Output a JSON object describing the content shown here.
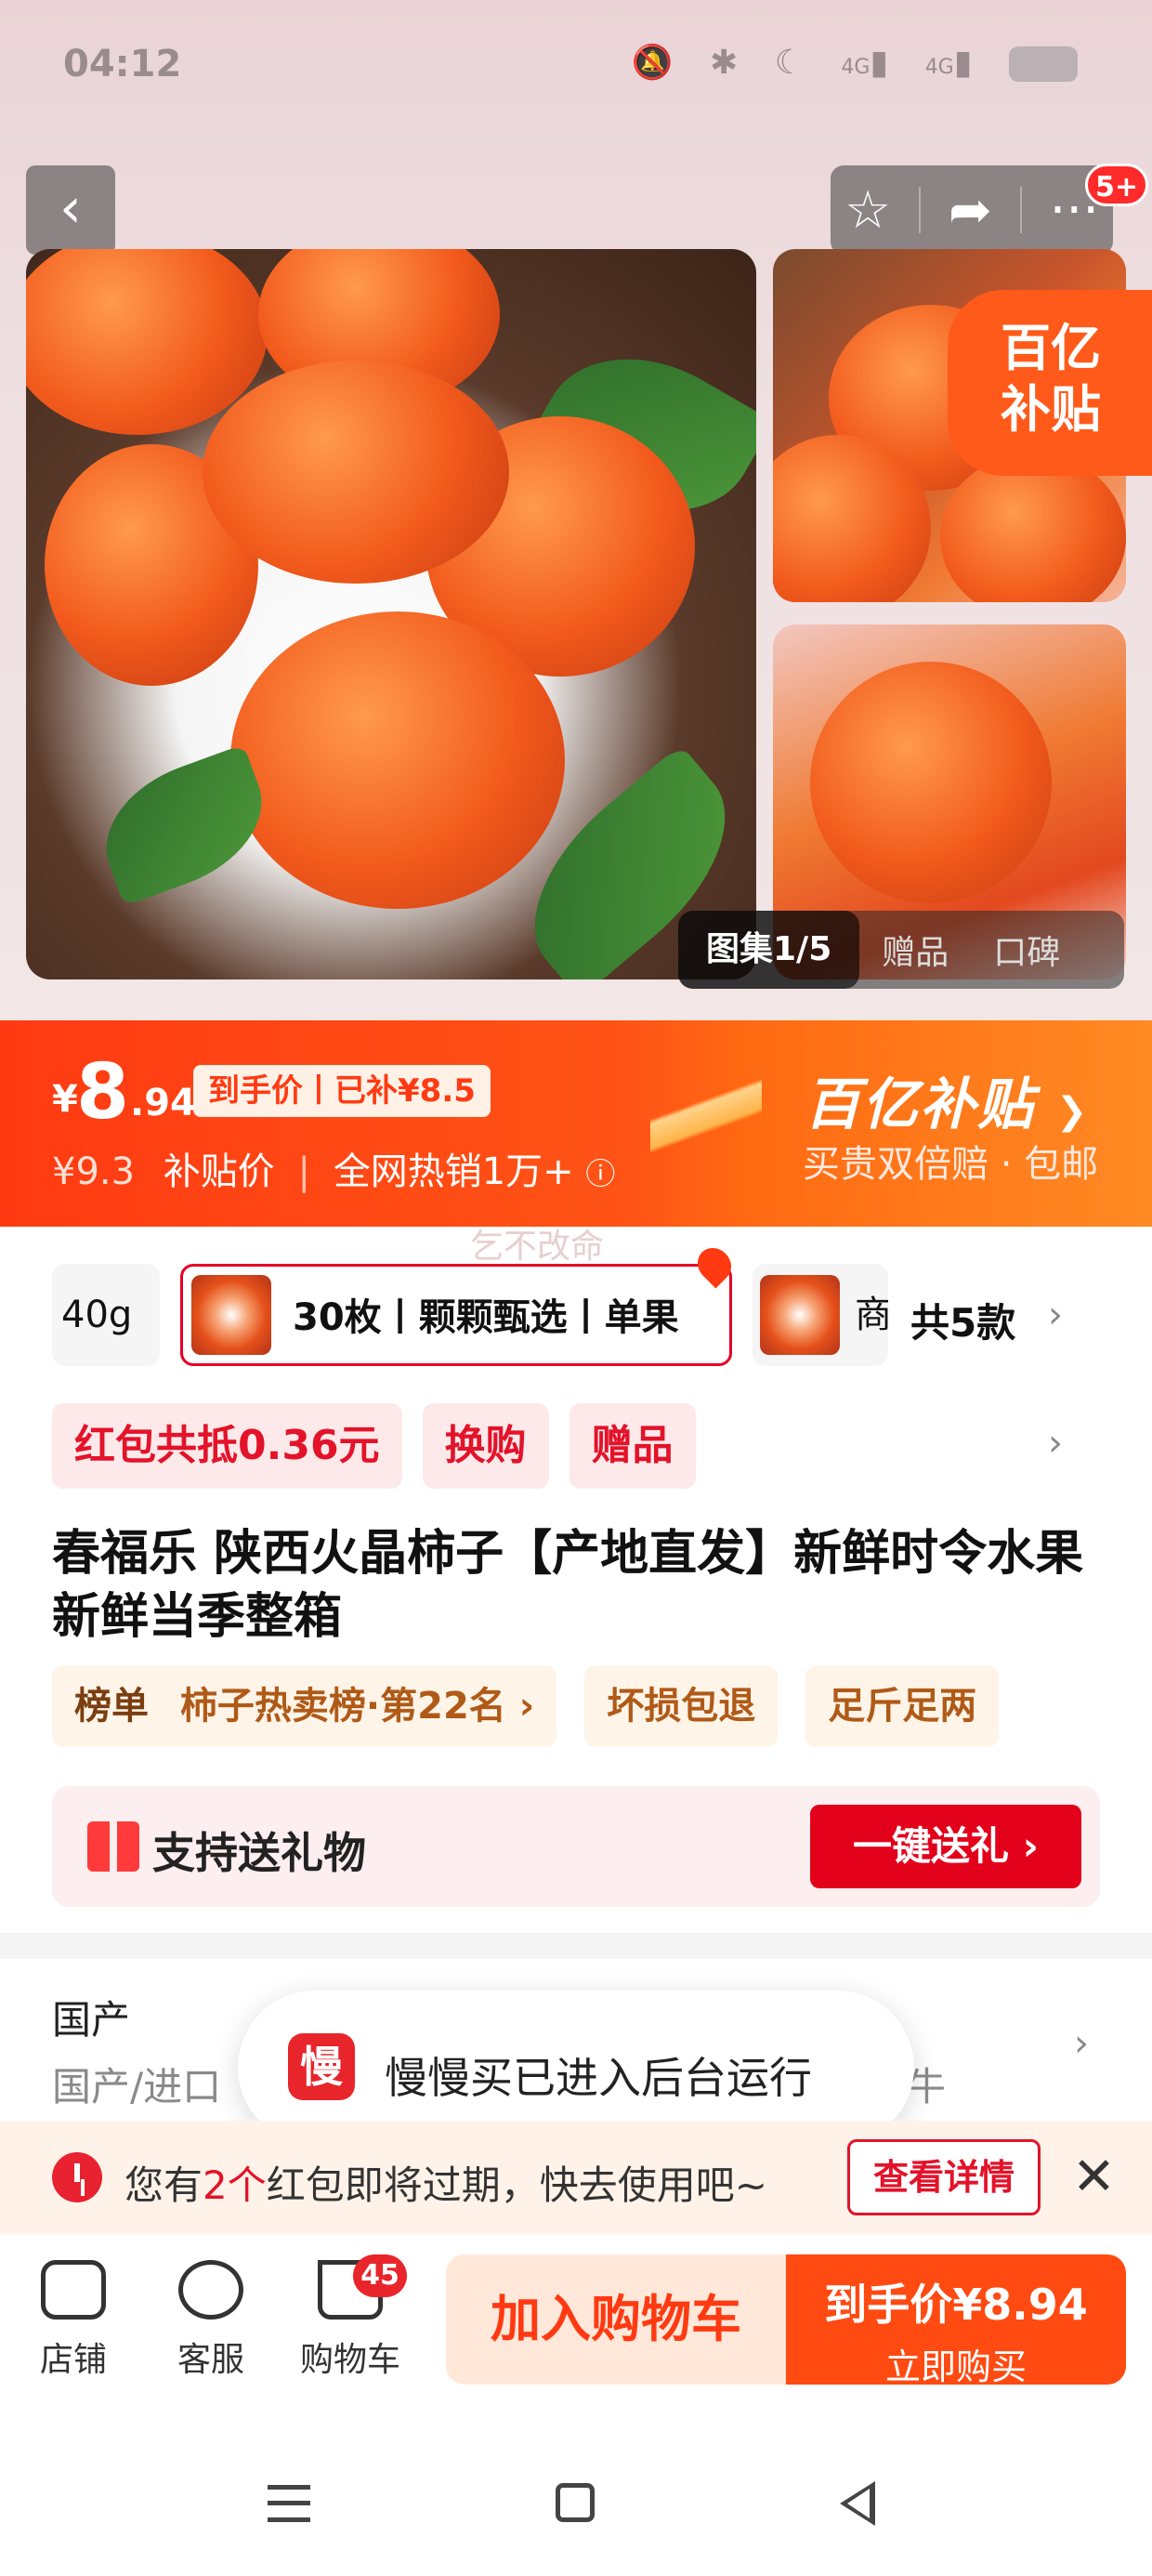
{
  "status_bar": {
    "time": "04:12",
    "icons": [
      "bell-off-icon",
      "bluetooth-icon",
      "moon-icon",
      "signal-4g-icon",
      "signal-4g-icon",
      "battery-icon"
    ],
    "network_1": "4G",
    "network_2": "4G"
  },
  "nav": {
    "back_icon": "chevron-left-icon",
    "favorite_icon": "star-icon",
    "share_icon": "share-icon",
    "more_icon": "more-dots-icon",
    "notification_badge": "5+"
  },
  "gallery": {
    "subsidy_tag_line1": "百亿",
    "subsidy_tag_line2": "补贴",
    "tabs": [
      {
        "label": "图集1/5",
        "active": true
      },
      {
        "label": "赠品",
        "active": false
      },
      {
        "label": "口碑",
        "active": false
      }
    ]
  },
  "price": {
    "currency": "¥",
    "integer": "8",
    "decimal": ".94",
    "tag": "到手价丨已补¥8.5",
    "original": "¥9.3",
    "original_label": "补贴价",
    "hot": "全网热销1万+",
    "info_icon": "info-icon",
    "promo_title": "百亿补贴",
    "promo_sub": "买贵双倍赔 · 包邮",
    "watermark": "乞不改命"
  },
  "variants": {
    "items": [
      {
        "label": "40g",
        "selected": false
      },
      {
        "label": "30枚丨颗颗甄选丨单果",
        "selected": true
      },
      {
        "label": "商",
        "selected": false
      }
    ],
    "total": "共5款"
  },
  "coupons": [
    "红包共抵0.36元",
    "换购",
    "赠品"
  ],
  "title": "春福乐 陕西火晶柿子【产地直发】新鲜时令水果新鲜当季整箱",
  "ranking": {
    "label": "榜单",
    "value": "柿子热卖榜·第22名 ›",
    "badges": [
      "坏损包退",
      "足斤足两"
    ]
  },
  "gift": {
    "text": "支持送礼物",
    "button": "一键送礼 ›"
  },
  "origin": {
    "title": "国产",
    "sub": "国产/进口",
    "tail": "牛"
  },
  "toast": {
    "icon_text": "慢",
    "message": "慢慢买已进入后台运行"
  },
  "notice": {
    "prefix": "您有",
    "count": "2个",
    "suffix": "红包即将过期，快去使用吧~",
    "button": "查看详情",
    "close": "✕"
  },
  "bottom_bar": {
    "shop": "店铺",
    "service": "客服",
    "cart": "购物车",
    "cart_badge": "45",
    "add_to_cart": "加入购物车",
    "buy_line1": "到手价¥8.94",
    "buy_line2": "立即购买"
  }
}
